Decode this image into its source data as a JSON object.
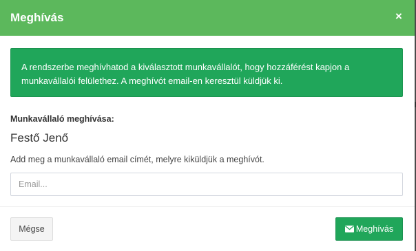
{
  "modal": {
    "title": "Meghívás",
    "close_glyph": "×"
  },
  "alert": {
    "text": "A rendszerbe meghívhatod a kiválasztott munkavállalót, hogy hozzáférést kapjon a munkavállalói felülethez. A meghívót email-en keresztül küldjük ki."
  },
  "form": {
    "section_label": "Munkavállaló meghívása:",
    "employee_name": "Festő Jenő",
    "help_text": "Add meg a munkavállaló email címét, melyre kiküldjük a meghívót.",
    "email": {
      "value": "",
      "placeholder": "Email..."
    }
  },
  "footer": {
    "cancel_label": "Mégse",
    "invite_label": "Meghívás",
    "invite_icon": "envelope-icon"
  },
  "colors": {
    "header": "#5cb85c",
    "success": "#20a65a",
    "default_button": "#f4f4f4"
  }
}
